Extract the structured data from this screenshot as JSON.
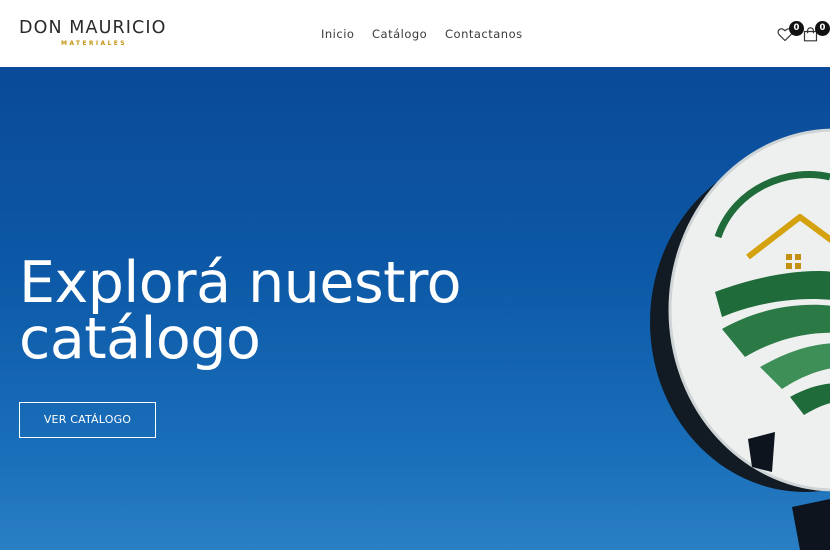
{
  "brand": {
    "name": "DON MAURICIO",
    "subtitle": "MATERIALES",
    "accent_color": "#c59412"
  },
  "nav": {
    "items": [
      {
        "label": "Inicio"
      },
      {
        "label": "Catálogo"
      },
      {
        "label": "Contactanos"
      }
    ]
  },
  "header_icons": {
    "wishlist": {
      "icon": "heart-icon",
      "count": "0"
    },
    "cart": {
      "icon": "shopping-bag-icon",
      "count": "0"
    }
  },
  "hero": {
    "title_line1": "Explorá nuestro",
    "title_line2": "catálogo",
    "button_label": "VER CATÁLOGO",
    "background_color": "#0d5aa8"
  }
}
